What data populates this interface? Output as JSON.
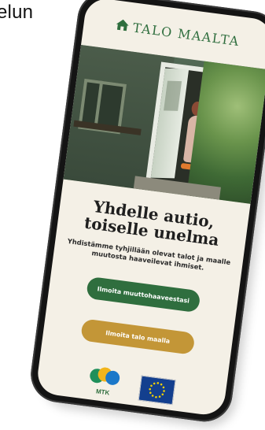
{
  "corner_text": "elun",
  "brand": {
    "name": "TALO MAALTA",
    "icon": "house-icon",
    "color": "#2f6e3e"
  },
  "hero": {
    "alt": ""
  },
  "headline": {
    "line1": "Yhdelle autio,",
    "line2": "toiselle unelma"
  },
  "subtext": "Yhdistämme tyhjillään olevat talot ja maalle muutosta haaveilevat ihmiset.",
  "buttons": {
    "primary": "Ilmoita muuttohaaveestasi",
    "secondary": "Ilmoita talo maalla"
  },
  "logos": {
    "mtk": "MTK",
    "eu_icon": "eu-flag-icon"
  },
  "colors": {
    "accent_green": "#2f6e3e",
    "accent_gold": "#c39637",
    "background": "#f4f0e6"
  }
}
